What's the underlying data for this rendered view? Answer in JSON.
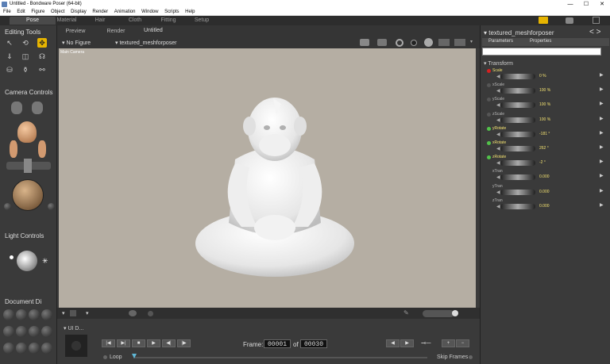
{
  "window": {
    "title": "Untitled - Bondware Poser (64-bit)",
    "controls": [
      "—",
      "☐",
      "✕"
    ]
  },
  "menu": [
    "File",
    "Edit",
    "Figure",
    "Object",
    "Display",
    "Render",
    "Animation",
    "Window",
    "Scripts",
    "Help"
  ],
  "rooms": {
    "tabs": [
      "Pose",
      "Material",
      "Hair",
      "Cloth",
      "Fitting",
      "Setup"
    ],
    "active": "Pose"
  },
  "left": {
    "editing_tools": "Editing Tools",
    "camera_controls": "Camera Controls",
    "light_controls": "Light Controls",
    "document_display": "Document Di",
    "ui_dots": "UI D..."
  },
  "document": {
    "tabs": [
      "Preview",
      "Render"
    ],
    "doc_title": "Untitled",
    "figure_dropdown": "No Figure",
    "prop_dropdown": "textured_meshforposer",
    "camera_label": "Main Camera"
  },
  "timeline": {
    "frame_label": "Frame:",
    "current_frame": "00001",
    "of_label": "of",
    "total_frames": "00030",
    "loop_label": "Loop",
    "skip_frames_label": "Skip Frames"
  },
  "right": {
    "object_title": "textured_meshforposer",
    "tabs": [
      "Parameters",
      "Properties"
    ],
    "group_label": "Transform",
    "params": [
      {
        "label": "Scale",
        "value": "0 %",
        "highlight": true,
        "dot": "#d62020"
      },
      {
        "label": "xScale",
        "value": "100 %",
        "highlight": false,
        "dot": "#555555"
      },
      {
        "label": "yScale",
        "value": "100 %",
        "highlight": false,
        "dot": "#555555"
      },
      {
        "label": "zScale",
        "value": "100 %",
        "highlight": false,
        "dot": "#555555"
      },
      {
        "label": "yRotate",
        "value": "-181 °",
        "highlight": true,
        "dot": "#52c24a"
      },
      {
        "label": "xRotate",
        "value": "262 °",
        "highlight": true,
        "dot": "#52c24a"
      },
      {
        "label": "zRotate",
        "value": "-2 °",
        "highlight": true,
        "dot": "#52c24a"
      },
      {
        "label": "xTran",
        "value": "0.000",
        "highlight": false,
        "dot": "none"
      },
      {
        "label": "yTran",
        "value": "0.000",
        "highlight": false,
        "dot": "none"
      },
      {
        "label": "zTran",
        "value": "0.000",
        "highlight": false,
        "dot": "none"
      }
    ]
  },
  "colors": {
    "accent": "#e6b400",
    "viewport_bg": "#b5aea3"
  }
}
